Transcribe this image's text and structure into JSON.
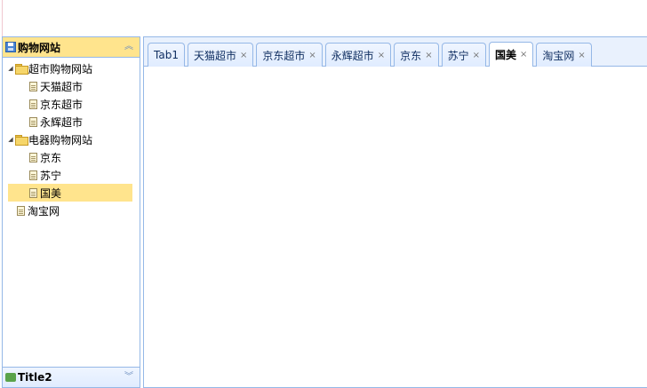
{
  "west": {
    "panel1_title": "购物网站",
    "panel2_title": "Title2",
    "tree": [
      {
        "label": "超市购物网站",
        "type": "folder",
        "level": 0
      },
      {
        "label": "天猫超市",
        "type": "file",
        "level": 1
      },
      {
        "label": "京东超市",
        "type": "file",
        "level": 1
      },
      {
        "label": "永辉超市",
        "type": "file",
        "level": 1
      },
      {
        "label": "电器购物网站",
        "type": "folder",
        "level": 0
      },
      {
        "label": "京东",
        "type": "file",
        "level": 1
      },
      {
        "label": "苏宁",
        "type": "file",
        "level": 1
      },
      {
        "label": "国美",
        "type": "file",
        "level": 1,
        "selected": true
      },
      {
        "label": "淘宝网",
        "type": "file",
        "level": 0
      }
    ]
  },
  "tabs": [
    {
      "label": "Tab1",
      "closable": false
    },
    {
      "label": "天猫超市",
      "closable": true
    },
    {
      "label": "京东超市",
      "closable": true
    },
    {
      "label": "永辉超市",
      "closable": true
    },
    {
      "label": "京东",
      "closable": true
    },
    {
      "label": "苏宁",
      "closable": true
    },
    {
      "label": "国美",
      "closable": true,
      "active": true
    },
    {
      "label": "淘宝网",
      "closable": true
    }
  ],
  "icons": {
    "close": "×",
    "collapse": "︽",
    "expand": "︾",
    "tree_open": "◢"
  },
  "colors": {
    "border": "#95b8e7",
    "selected": "#ffe48d",
    "tab_bg": "#e0ecff"
  }
}
